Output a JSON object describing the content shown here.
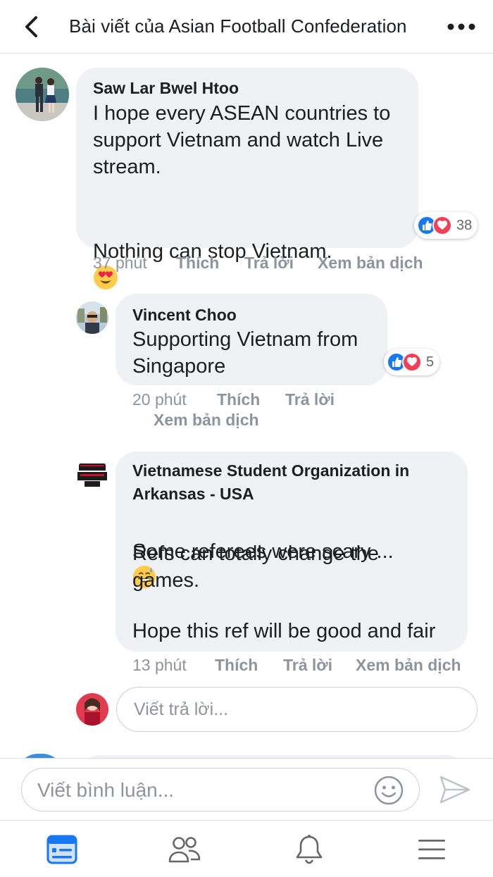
{
  "header": {
    "title": "Bài viết của Asian Football Confederation",
    "back_icon": "chevron-left-icon",
    "more_icon": "more-horizontal-icon"
  },
  "comments": [
    {
      "author": "Saw Lar Bwel Htoo",
      "text": "I hope every ASEAN countries to support Vietnam and watch Live stream.",
      "text2": "Nothing can stop Vietnam.",
      "emoji": "heart-eyes-emoji",
      "reactions": {
        "icons": [
          "like",
          "love"
        ],
        "count": "38"
      },
      "time": "37 phút",
      "like_label": "Thích",
      "reply_label": "Trả lời",
      "translate_label": "Xem bản dịch"
    },
    {
      "author": "Vincent Choo",
      "text": "Supporting Vietnam from Singapore",
      "reactions": {
        "icons": [
          "like",
          "love"
        ],
        "count": "5"
      },
      "time": "20 phút",
      "like_label": "Thích",
      "reply_label": "Trả lời",
      "translate_label": "Xem bản dịch"
    },
    {
      "author": "Vietnamese Student Organization in Arkansas - USA",
      "text": "Some referees were scary ...",
      "emoji": "grinning-sweat-emoji",
      "text2": "Refs can totally change the games.",
      "text3": "Hope this ref will be good and fair",
      "time": "13 phút",
      "like_label": "Thích",
      "reply_label": "Trả lời",
      "translate_label": "Xem bản dịch"
    }
  ],
  "reply_box": {
    "placeholder": "Viết trả lời..."
  },
  "composer": {
    "placeholder": "Viết bình luận...",
    "emoji_icon": "smiley-icon",
    "send_icon": "send-icon"
  },
  "tabbar": [
    {
      "icon": "news-feed-icon",
      "active": true
    },
    {
      "icon": "friends-icon",
      "active": false
    },
    {
      "icon": "notifications-bell-icon",
      "active": false
    },
    {
      "icon": "menu-icon",
      "active": false
    }
  ],
  "colors": {
    "accent": "#1877f2",
    "love": "#f33e58",
    "bubble": "#f0f1f4",
    "meta": "#8d949e"
  }
}
